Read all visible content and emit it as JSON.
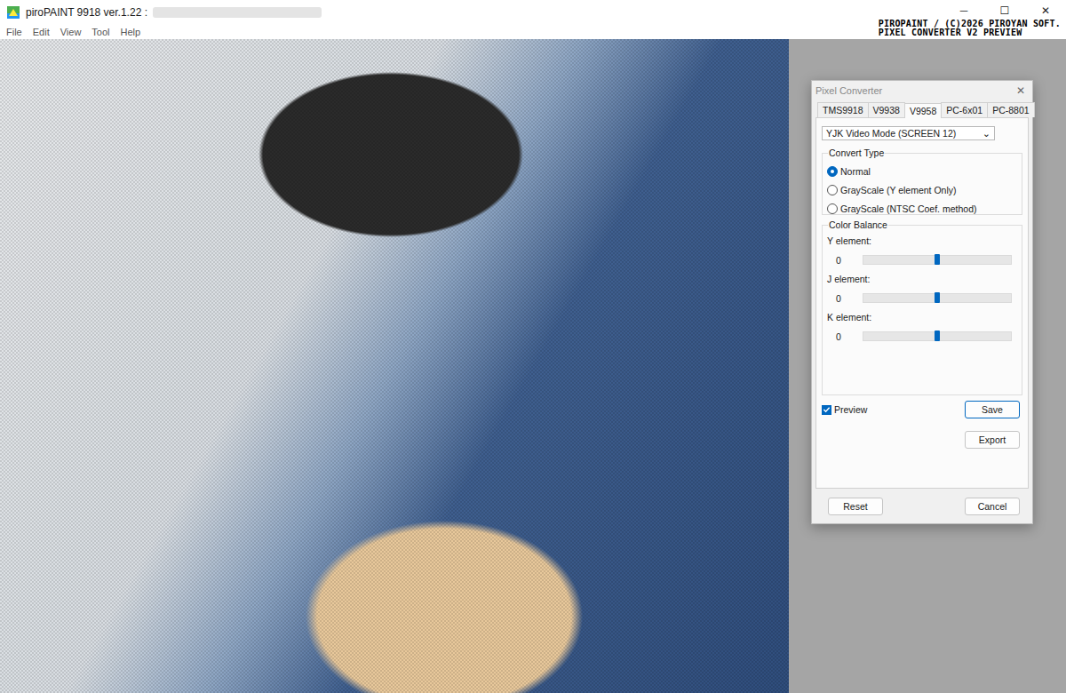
{
  "window": {
    "title": "piroPAINT 9918 ver.1.22 :",
    "controls": [
      "─",
      "☐",
      "✕"
    ]
  },
  "menu": [
    "File",
    "Edit",
    "View",
    "Tool",
    "Help"
  ],
  "banner": [
    "PIROPAINT / (C)2026 PIROYAN SOFT.",
    "PIXEL CONVERTER V2 PREVIEW"
  ],
  "dialog": {
    "title": "Pixel Converter",
    "close": "✕",
    "tabs": [
      {
        "label": "TMS9918",
        "selected": false
      },
      {
        "label": "V9938",
        "selected": false
      },
      {
        "label": "V9958",
        "selected": true
      },
      {
        "label": "PC-6x01",
        "selected": false
      },
      {
        "label": "PC-8801",
        "selected": false
      }
    ],
    "mode": {
      "value": "YJK Video Mode (SCREEN 12)",
      "arrow": "⌄"
    },
    "convert_type": {
      "label": "Convert Type",
      "options": [
        {
          "label": "Normal",
          "selected": true
        },
        {
          "label": "GrayScale (Y element Only)",
          "selected": false
        },
        {
          "label": "GrayScale (NTSC Coef. method)",
          "selected": false
        }
      ]
    },
    "color_balance": {
      "label": "Color Balance",
      "sliders": [
        {
          "label": "Y element:",
          "reading": "0",
          "level": 0.5
        },
        {
          "label": "J element:",
          "reading": "0",
          "level": 0.5
        },
        {
          "label": "K element:",
          "reading": "0",
          "level": 0.5
        }
      ]
    },
    "preview": {
      "label": "Preview",
      "checked": true
    },
    "side_buttons": [
      {
        "label": "Save",
        "focused": true
      },
      {
        "label": "Export",
        "focused": false
      }
    ],
    "footer_buttons": [
      {
        "label": "Reset",
        "focused": false
      },
      {
        "label": "Cancel",
        "focused": false
      }
    ]
  }
}
